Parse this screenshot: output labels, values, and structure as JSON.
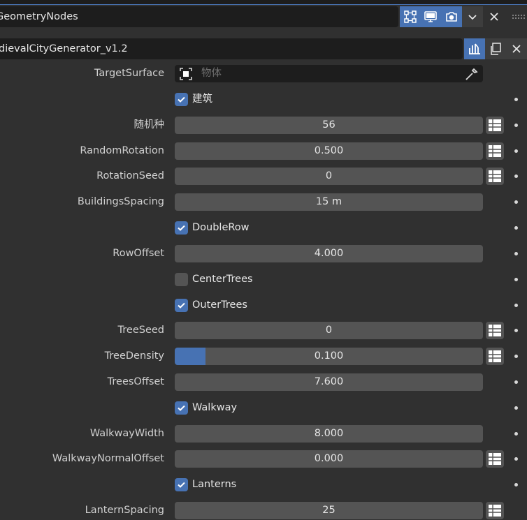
{
  "modifier": {
    "name": "GeometryNodes",
    "toggles": [
      {
        "name": "edit-mode-toggle",
        "icon": "edit-mode-icon",
        "active": true
      },
      {
        "name": "viewport-toggle",
        "icon": "monitor-icon",
        "active": true
      },
      {
        "name": "render-toggle",
        "icon": "camera-icon",
        "active": true
      }
    ],
    "dropdown_icon": "chevron-down-icon",
    "close_icon": "close-icon",
    "drag_icon": "drag-handle-icon"
  },
  "node_group": {
    "name": "dievalCityGenerator_v1.2",
    "icons": [
      "node-tree-icon",
      "duplicate-icon",
      "close-icon"
    ]
  },
  "inputs": [
    {
      "type": "object",
      "label": "TargetSurface",
      "placeholder": "物体"
    },
    {
      "type": "checkbox",
      "label": "建筑",
      "checked": true
    },
    {
      "type": "number",
      "label": "随机种",
      "value": "56",
      "attr_toggle": true
    },
    {
      "type": "number",
      "label": "RandomRotation",
      "value": "0.500",
      "attr_toggle": true
    },
    {
      "type": "number",
      "label": "RotationSeed",
      "value": "0",
      "attr_toggle": true
    },
    {
      "type": "number",
      "label": "BuildingsSpacing",
      "value": "15 m",
      "attr_toggle": false
    },
    {
      "type": "checkbox",
      "label": "DoubleRow",
      "checked": true
    },
    {
      "type": "number",
      "label": "RowOffset",
      "value": "4.000",
      "attr_toggle": false
    },
    {
      "type": "checkbox",
      "label": "CenterTrees",
      "checked": false
    },
    {
      "type": "checkbox",
      "label": "OuterTrees",
      "checked": true
    },
    {
      "type": "number",
      "label": "TreeSeed",
      "value": "0",
      "attr_toggle": true
    },
    {
      "type": "slider",
      "label": "TreeDensity",
      "value": "0.100",
      "fraction": 0.1,
      "attr_toggle": true
    },
    {
      "type": "number",
      "label": "TreesOffset",
      "value": "7.600",
      "attr_toggle": false
    },
    {
      "type": "checkbox",
      "label": "Walkway",
      "checked": true
    },
    {
      "type": "number",
      "label": "WalkwayWidth",
      "value": "8.000",
      "attr_toggle": false
    },
    {
      "type": "number",
      "label": "WalkwayNormalOffset",
      "value": "0.000",
      "attr_toggle": true
    },
    {
      "type": "checkbox",
      "label": "Lanterns",
      "checked": true
    },
    {
      "type": "number",
      "label": "LanternSpacing",
      "value": "25",
      "attr_toggle": true
    }
  ],
  "colors": {
    "accent": "#4772b3",
    "panel": "#303030",
    "field": "#545454",
    "dark": "#1d1d1d"
  }
}
